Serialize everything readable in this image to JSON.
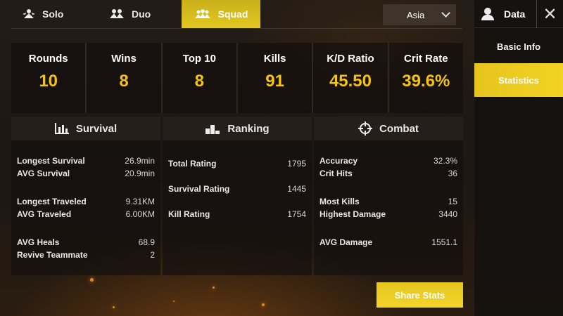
{
  "modes": [
    {
      "label": "Solo",
      "icon": "solo-icon",
      "active": false
    },
    {
      "label": "Duo",
      "icon": "duo-icon",
      "active": false
    },
    {
      "label": "Squad",
      "icon": "squad-icon",
      "active": true
    }
  ],
  "region": {
    "value": "Asia"
  },
  "sidebar": {
    "title": "Data",
    "items": [
      {
        "label": "Basic Info",
        "active": false
      },
      {
        "label": "Statistics",
        "active": true
      }
    ]
  },
  "summary": [
    {
      "label": "Rounds",
      "value": "10"
    },
    {
      "label": "Wins",
      "value": "8"
    },
    {
      "label": "Top 10",
      "value": "8"
    },
    {
      "label": "Kills",
      "value": "91"
    },
    {
      "label": "K/D Ratio",
      "value": "45.50"
    },
    {
      "label": "Crit Rate",
      "value": "39.6%"
    }
  ],
  "survival": {
    "title": "Survival",
    "rows": [
      {
        "label": "Longest Survival",
        "value": "26.9min"
      },
      {
        "label": "AVG Survival",
        "value": "20.9min"
      },
      {
        "label": "Longest Traveled",
        "value": "9.31KM"
      },
      {
        "label": "AVG Traveled",
        "value": "6.00KM"
      },
      {
        "label": "AVG Heals",
        "value": "68.9"
      },
      {
        "label": "Revive Teammate",
        "value": "2"
      }
    ]
  },
  "ranking": {
    "title": "Ranking",
    "rows": [
      {
        "label": "Total Rating",
        "value": "1795"
      },
      {
        "label": "Survival Rating",
        "value": "1445"
      },
      {
        "label": "Kill Rating",
        "value": "1754"
      }
    ]
  },
  "combat": {
    "title": "Combat",
    "rows": [
      {
        "label": "Accuracy",
        "value": "32.3%"
      },
      {
        "label": "Crit Hits",
        "value": "36"
      },
      {
        "label": "Most Kills",
        "value": "15"
      },
      {
        "label": "Highest Damage",
        "value": "3440"
      },
      {
        "label": "AVG Damage",
        "value": "1551.1"
      }
    ]
  },
  "share_label": "Share Stats",
  "colors": {
    "accent": "#f2c40f",
    "tab_active": "#e3c81f"
  }
}
